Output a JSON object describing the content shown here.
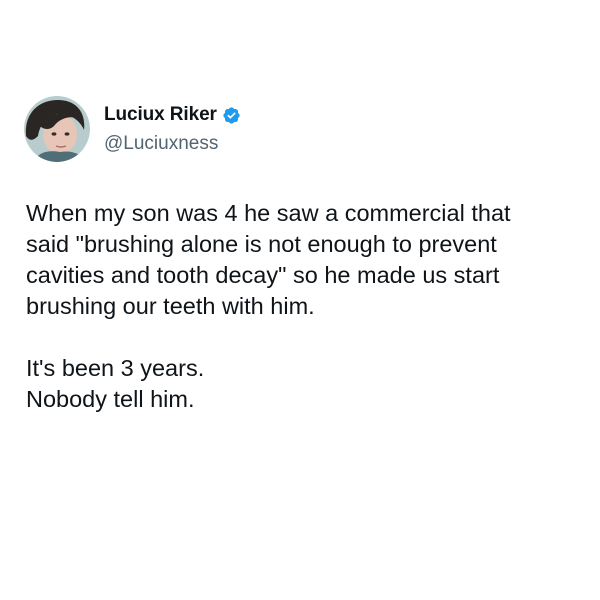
{
  "tweet": {
    "author": {
      "display_name": "Luciux Riker",
      "handle": "@Luciuxness",
      "verified": true,
      "avatar_icon": "profile-photo",
      "verified_icon": "verified-badge-icon",
      "verified_color": "#1d9bf0"
    },
    "paragraphs": [
      "When my son was 4 he saw a commercial that\nsaid \"brushing alone is not enough to prevent\ncavities and tooth decay\" so he made us start\nbrushing our teeth with him.",
      "It's been 3 years.\nNobody tell him."
    ],
    "colors": {
      "text": "#0f1419",
      "secondary_text": "#536471",
      "background": "#ffffff"
    }
  }
}
